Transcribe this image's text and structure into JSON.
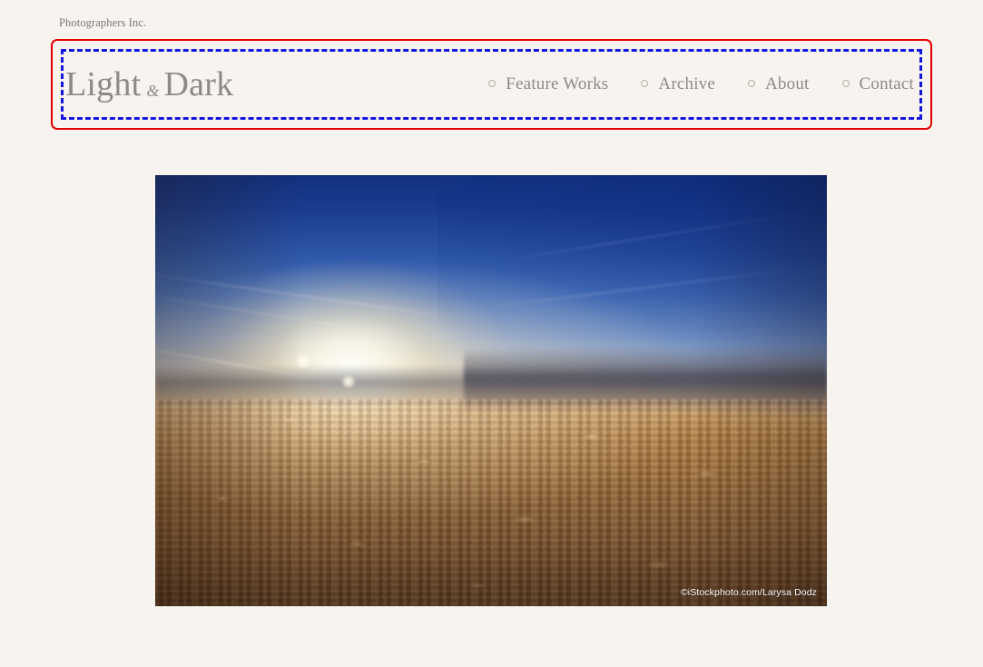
{
  "page": {
    "background_color": "#f7f4ef",
    "brand_line": "Photographers Inc.",
    "text_color": "#8d8a85"
  },
  "annotation": {
    "outer_box_color": "#e50000",
    "inner_box_color": "#1414e6",
    "outer_style": "solid",
    "inner_style": "dashed"
  },
  "header": {
    "logo": {
      "first_word": "Light",
      "ampersand": "&",
      "second_word": "Dark"
    },
    "nav": {
      "bullet_icon": "small-circle-icon",
      "items": [
        {
          "label": "Feature Works"
        },
        {
          "label": "Archive"
        },
        {
          "label": "About"
        },
        {
          "label": "Contact"
        }
      ]
    }
  },
  "hero": {
    "image_alt": "Sunset above a cloud deck seen from an airplane window",
    "credit": "©iStockphoto.com/Larysa Dodz"
  }
}
